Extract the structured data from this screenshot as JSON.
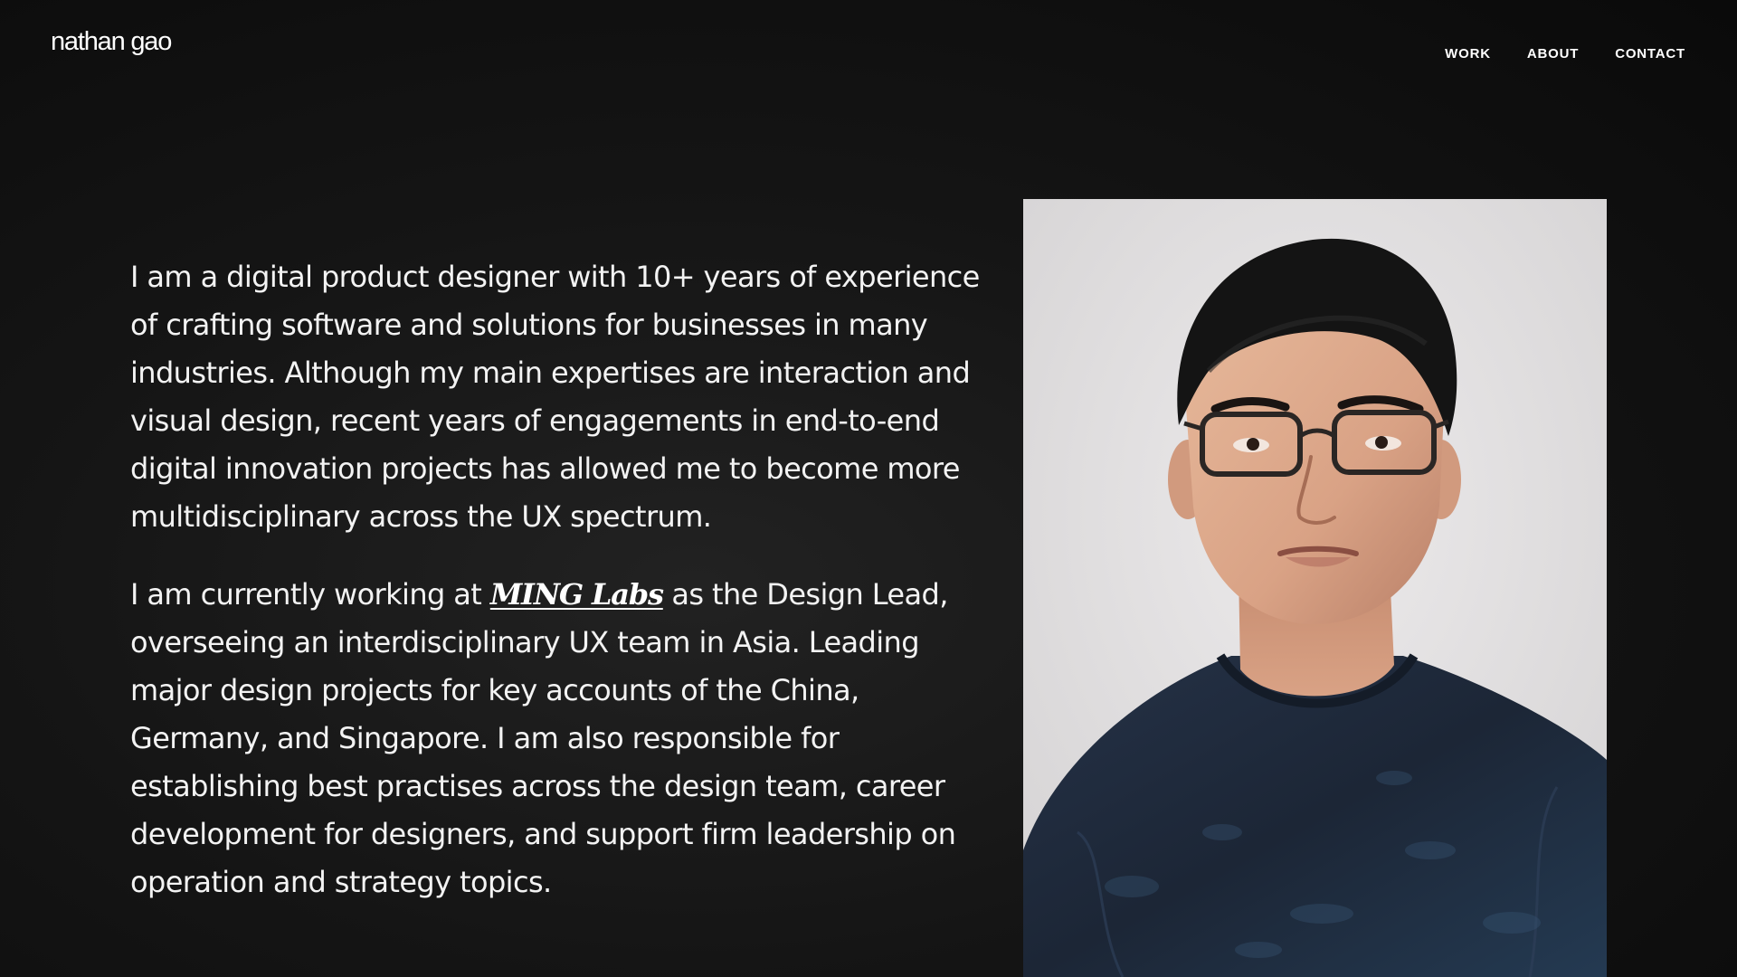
{
  "header": {
    "logo": "nathan gao",
    "nav": [
      {
        "label": "WORK"
      },
      {
        "label": "ABOUT"
      },
      {
        "label": "CONTACT"
      }
    ]
  },
  "bio": {
    "paragraph_1": "I am a digital product designer with 10+ years of experience of crafting software and solutions for businesses in many industries. Although my main expertises are interaction and visual design, recent years of engagements in end-to-end digital innovation projects has allowed me to become more multidisciplinary across the UX spectrum.",
    "paragraph_2_before": "I am currently working at ",
    "paragraph_2_link": "MING Labs",
    "paragraph_2_after": " as the Design Lead, overseeing an interdisciplinary UX team in Asia. Leading major design projects for key accounts of the China, Germany, and Singapore. I am also responsible for establishing best practises across the design team, career development for designers, and support firm leadership on operation and strategy topics."
  },
  "colors": {
    "background": "#111111",
    "text": "#f3f3f3",
    "photo_background": "#e2e0e1",
    "shirt": "#1f2a3a"
  }
}
